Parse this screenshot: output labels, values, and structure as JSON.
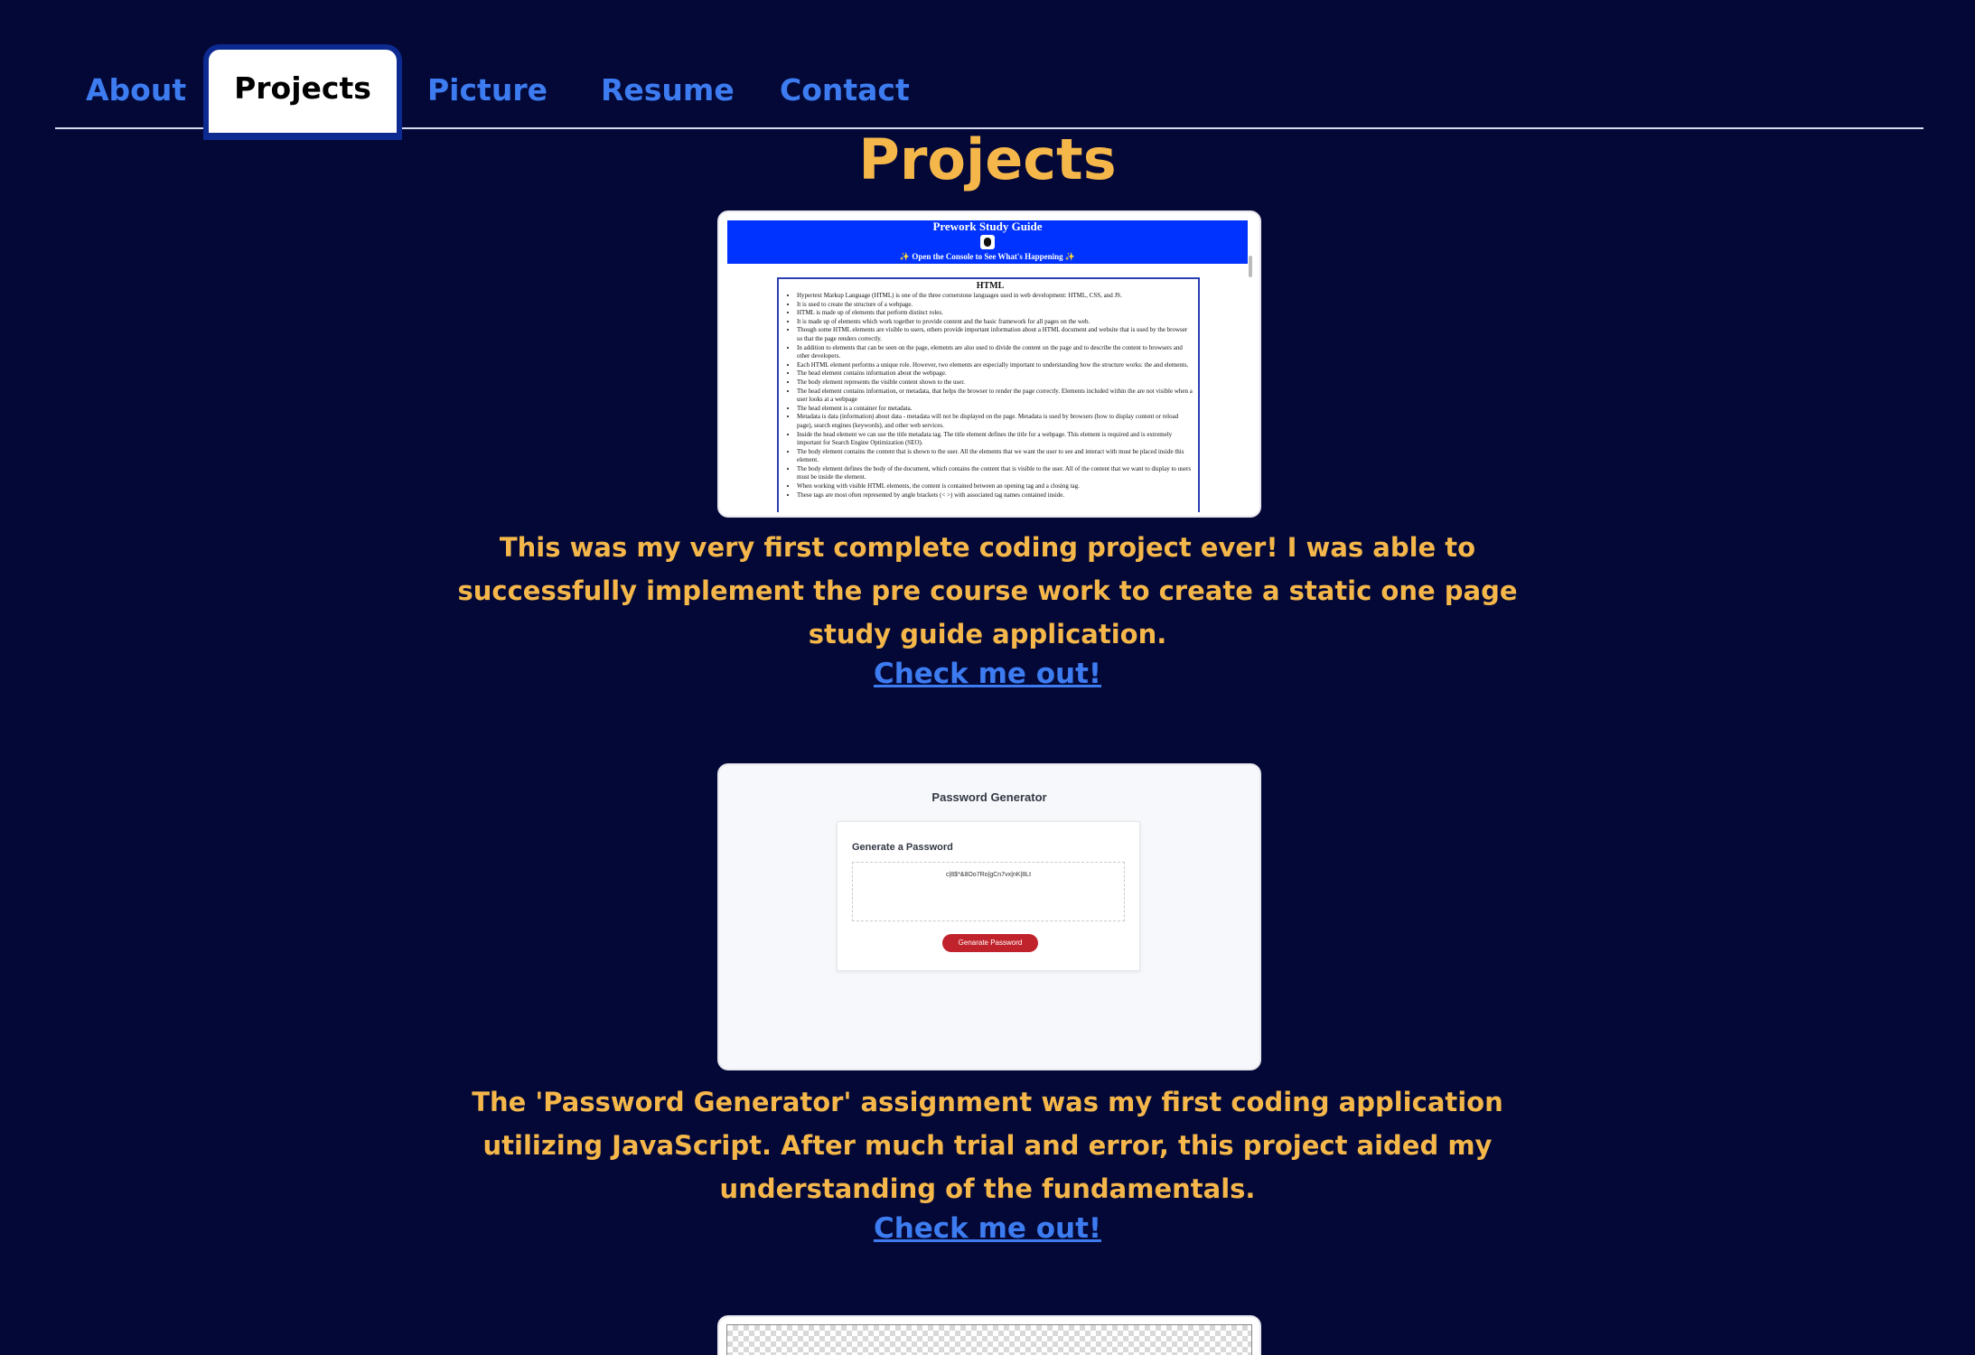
{
  "nav": {
    "tabs": [
      {
        "label": "About",
        "active": false
      },
      {
        "label": "Projects",
        "active": true
      },
      {
        "label": "Picture",
        "active": false
      },
      {
        "label": "Resume",
        "active": false
      },
      {
        "label": "Contact",
        "active": false
      }
    ]
  },
  "section": {
    "title": "Projects"
  },
  "projects": [
    {
      "description": "This was my very first complete coding project ever! I was able to successfully implement the pre course work to create a static one page study guide application.",
      "link_label": "Check me out!",
      "screenshot": {
        "banner_title": "Prework Study Guide",
        "banner_subtitle": "✨ Open the Console to See What's Happening ✨",
        "box_title": "HTML",
        "bullets": [
          "Hypertext Markup Language (HTML) is one of the three cornerstone languages used in web development: HTML, CSS, and JS.",
          "It is used to create the structure of a webpage.",
          "HTML is made up of elements that perform distinct roles.",
          "It is made up of elements which work together to provide content and the basic framework for all pages on the web.",
          "Though some HTML elements are visible to users, others provide important information about a HTML document and website that is used by the browser so that the page renders correctly.",
          "In addition to elements that can be seen on the page, elements are also used to divide the content on the page and to describe the content to browsers and other developers.",
          "Each HTML element performs a unique role. However, two elements are especially important to understanding how the structure works: the and elements.",
          "The head element contains information about the webpage.",
          "The body element represents the visible content shown to the user.",
          "The head element contains information, or metadata, that helps the browser to render the page correctly. Elements included within the are not visible when a user looks at a webpage",
          "The head element is a container for metadata.",
          "Metadata is data (information) about data - metadata will not be displayed on the page. Metadata is used by browsers (how to display content or reload page), search engines (keywords), and other web services.",
          "Inside the head element we can use the title metadata tag. The title element defines the title for a webpage. This element is required and is extremely important for Search Engine Optimization (SEO).",
          "The body element contains the content that is shown to the user. All the elements that we want the user to see and interact with must be placed inside this element.",
          "The body element defines the body of the document, which contains the content that is visible to the user. All of the content that we want to display to users must be inside the element.",
          "When working with visible HTML elements, the content is contained between an opening tag and a closing tag.",
          "These tags are most often represented by angle brackets (< >) with associated tag names contained inside."
        ]
      }
    },
    {
      "description": "The 'Password Generator' assignment was my first coding application utilizing JavaScript. After much trial and error, this project aided my understanding of the fundamentals.",
      "link_label": "Check me out!",
      "screenshot": {
        "app_title": "Password Generator",
        "card_title": "Generate a Password",
        "password_value": "c|8$*&8Oo7Ro|gCn7vx|nK|8Lt",
        "button_label": "Genarate Password"
      }
    }
  ],
  "colors": {
    "background": "#030837",
    "accent": "#f5b74a",
    "link": "#3d7cf0",
    "active_tab_border": "#0d2a90"
  }
}
